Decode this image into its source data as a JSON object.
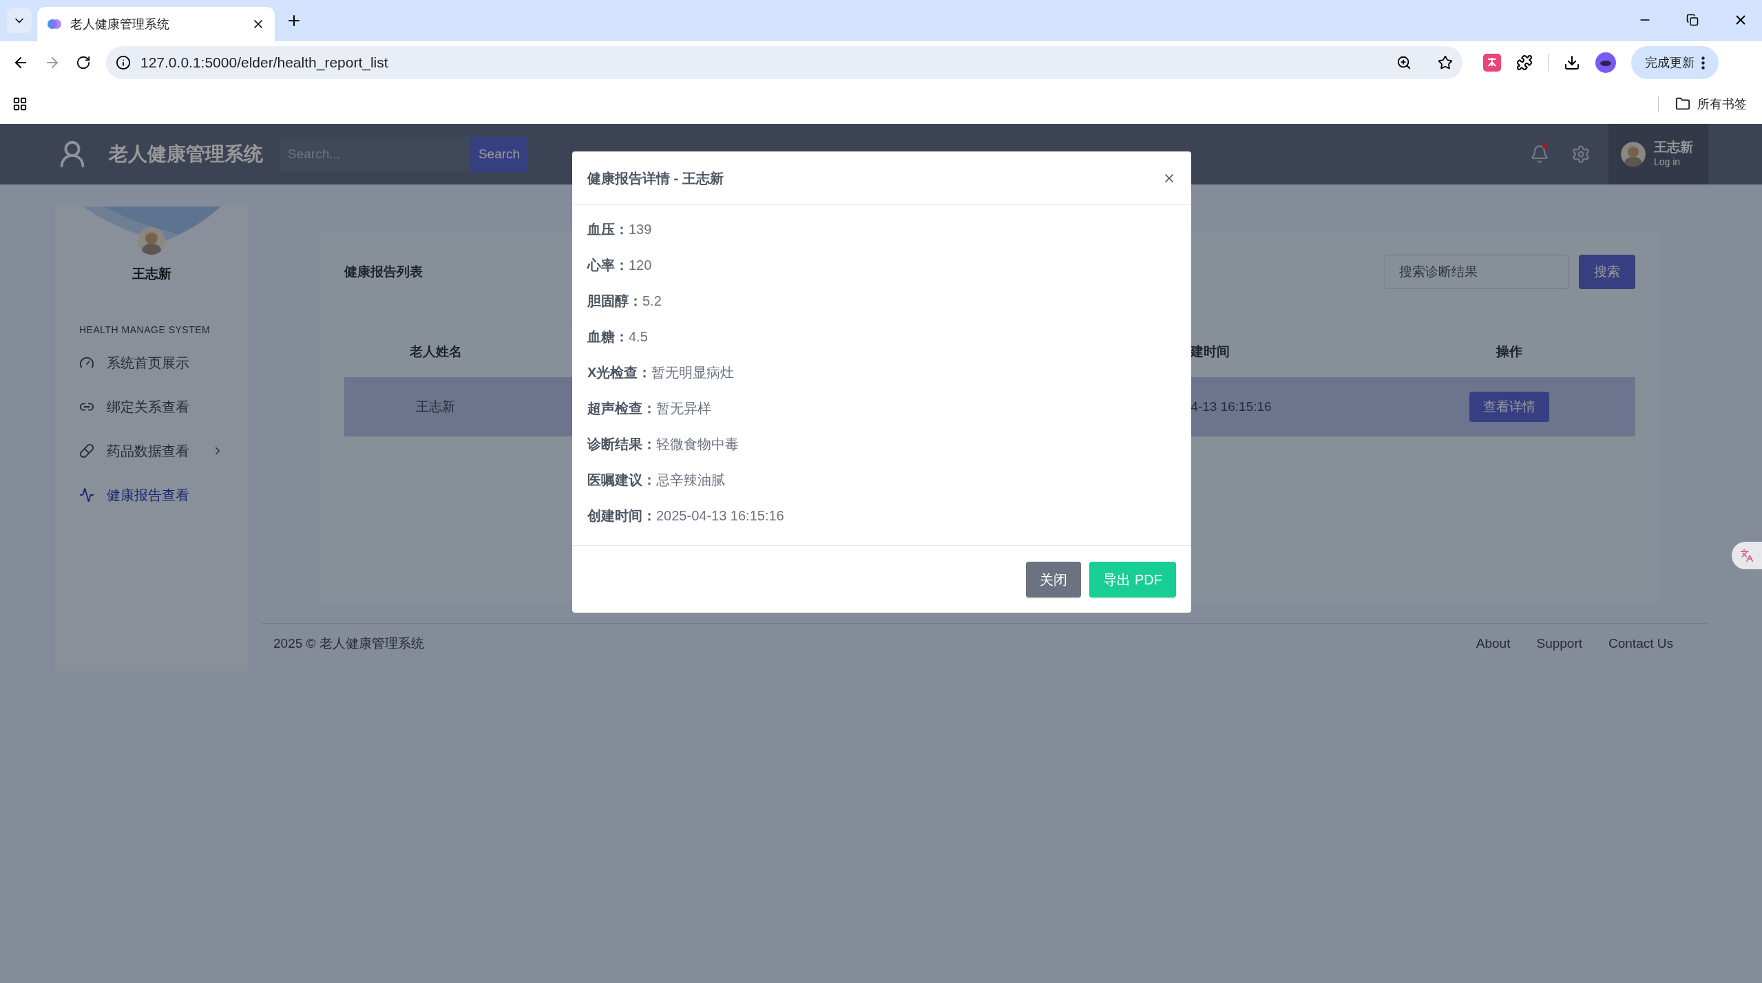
{
  "browser": {
    "tabs": [
      {
        "title": "老人健康管理系统",
        "selected": true
      }
    ],
    "address": "127.0.0.1:5000/elder/health_report_list",
    "update_button": "完成更新",
    "bookmarks_folder": "所有书签"
  },
  "header": {
    "title": "老人健康管理系统",
    "search_placeholder": "Search...",
    "search_button": "Search",
    "notification_unread": true,
    "user": {
      "name": "王志新",
      "status": "Log in"
    }
  },
  "sidebar": {
    "name": "王志新",
    "section": "HEALTH MANAGE SYSTEM",
    "items": [
      {
        "label": "系统首页展示",
        "kind": "gauge",
        "selected": false,
        "has_submenu": false
      },
      {
        "label": "绑定关系查看",
        "kind": "link",
        "selected": false,
        "has_submenu": false
      },
      {
        "label": "药品数据查看",
        "kind": "pill",
        "selected": false,
        "has_submenu": true
      },
      {
        "label": "健康报告查看",
        "kind": "chart",
        "selected": true,
        "has_submenu": false
      }
    ]
  },
  "content": {
    "title": "健康报告列表",
    "search_placeholder": "搜索诊断结果",
    "search_button": "搜索",
    "table": {
      "columns": [
        "老人姓名",
        "建时间",
        "操作"
      ],
      "rows": [
        {
          "cells": [
            "王志新",
            "4-13 16:15:16"
          ],
          "action": "查看详情",
          "highlighted": true
        }
      ]
    }
  },
  "footer": {
    "copyright": "2025 © 老人健康管理系统",
    "links": [
      "About",
      "Support",
      "Contact Us"
    ]
  },
  "modal": {
    "title": "健康报告详情 - 王志新",
    "fields": [
      {
        "label": "血压：",
        "value": "139"
      },
      {
        "label": "心率：",
        "value": "120"
      },
      {
        "label": "胆固醇：",
        "value": "5.2"
      },
      {
        "label": "血糖：",
        "value": "4.5"
      },
      {
        "label": "X光检查：",
        "value": "暂无明显病灶"
      },
      {
        "label": "超声检查：",
        "value": "暂无异样"
      },
      {
        "label": "诊断结果：",
        "value": "轻微食物中毒"
      },
      {
        "label": "医嘱建议：",
        "value": "忌辛辣油腻"
      },
      {
        "label": "创建时间：",
        "value": "2025-04-13 16:15:16"
      }
    ],
    "buttons": [
      {
        "label": "关闭",
        "kind": "secondary"
      },
      {
        "label": "导出 PDF",
        "kind": "primary"
      }
    ]
  }
}
